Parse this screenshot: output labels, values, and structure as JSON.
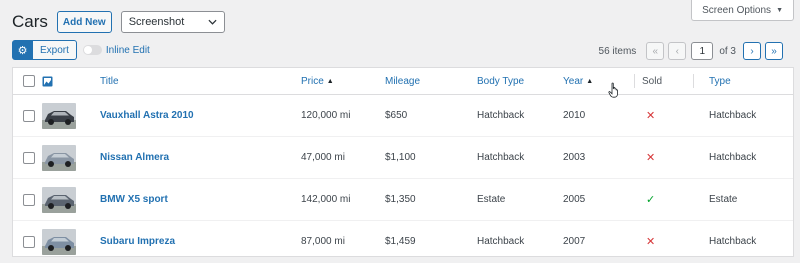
{
  "screen_options": {
    "label": "Screen Options",
    "arrow": "▼"
  },
  "header": {
    "title": "Cars",
    "add_new": "Add New",
    "view_select": "Screenshot"
  },
  "toolbar": {
    "gear_icon": "⚙",
    "export": "Export",
    "inline_edit": "Inline Edit"
  },
  "pagination": {
    "count": "56 items",
    "first": "«",
    "prev": "‹",
    "current": "1",
    "of": "of 3",
    "next": "›",
    "last": "»"
  },
  "table": {
    "columns": {
      "title": "Title",
      "price": "Price",
      "mileage": "Mileage",
      "body_type": "Body Type",
      "year": "Year",
      "sold": "Sold",
      "type": "Type"
    },
    "rows": [
      {
        "title": "Vauxhall Astra 2010",
        "price": "120,000 mi",
        "mileage": "$650",
        "body_type": "Hatchback",
        "year": "2010",
        "sold": "✕",
        "type": "Hatchback",
        "car_color": "#3a3f47"
      },
      {
        "title": "Nissan Almera",
        "price": "47,000 mi",
        "mileage": "$1,100",
        "body_type": "Hatchback",
        "year": "2003",
        "sold": "✕",
        "type": "Hatchback",
        "car_color": "#8a96a4"
      },
      {
        "title": "BMW X5 sport",
        "price": "142,000 mi",
        "mileage": "$1,350",
        "body_type": "Estate",
        "year": "2005",
        "sold": "✓",
        "type": "Estate",
        "car_color": "#5b6470"
      },
      {
        "title": "Subaru Impreza",
        "price": "87,000 mi",
        "mileage": "$1,459",
        "body_type": "Hatchback",
        "year": "2007",
        "sold": "✕",
        "type": "Hatchback",
        "car_color": "#7e8fa3"
      }
    ]
  },
  "colors": {
    "accent": "#2271b1",
    "cross": "#d63638",
    "tick": "#00a32a"
  }
}
